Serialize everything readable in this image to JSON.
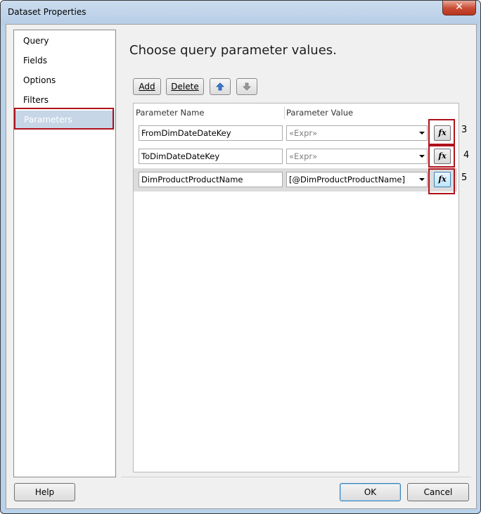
{
  "window": {
    "title": "Dataset Properties",
    "close_glyph": "✕"
  },
  "nav": {
    "items": [
      {
        "label": "Query"
      },
      {
        "label": "Fields"
      },
      {
        "label": "Options"
      },
      {
        "label": "Filters"
      },
      {
        "label": "Parameters",
        "selected": true
      }
    ]
  },
  "main": {
    "heading": "Choose query parameter values."
  },
  "toolbar": {
    "add_label": "Add",
    "delete_label": "Delete",
    "move_up_icon": "arrow-up-icon",
    "move_down_icon": "arrow-down-icon"
  },
  "grid": {
    "columns": [
      "Parameter Name",
      "Parameter Value"
    ],
    "rows": [
      {
        "name": "FromDimDateDateKey",
        "value": "«Expr»",
        "annotation": "3"
      },
      {
        "name": "ToDimDateDateKey",
        "value": "«Expr»",
        "annotation": "4"
      },
      {
        "name": "DimProductProductName",
        "value": "[@DimProductProductName]",
        "annotation": "5"
      }
    ],
    "fx_label": "fx"
  },
  "footer": {
    "help_label": "Help",
    "ok_label": "OK",
    "cancel_label": "Cancel"
  },
  "colors": {
    "highlight_box": "#b0121b",
    "selected_nav": "#c6d6e6"
  }
}
